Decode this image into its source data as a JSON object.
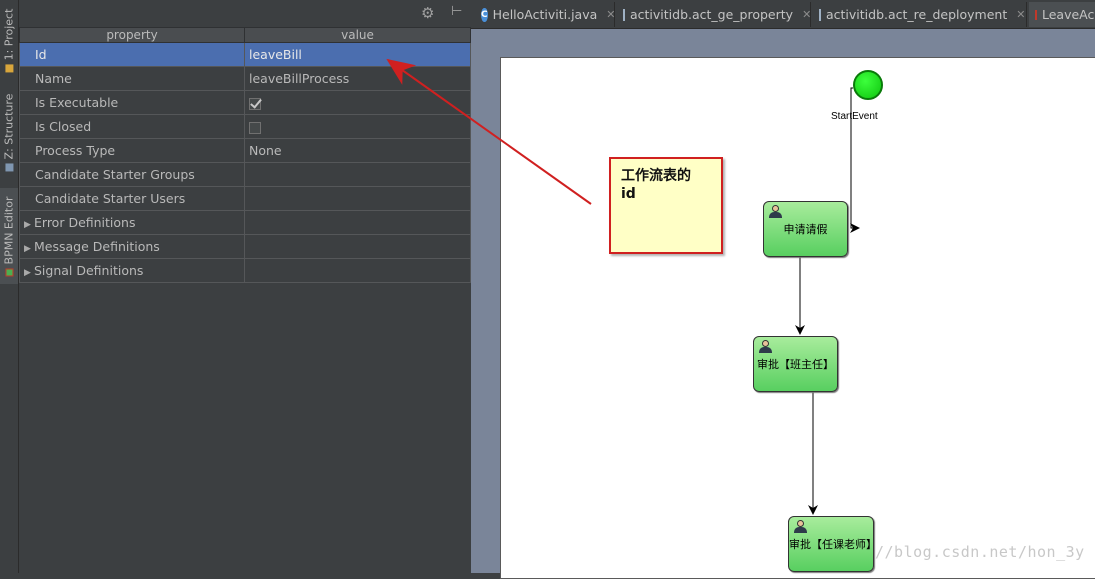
{
  "side_tabs": [
    {
      "label": "1: Project"
    },
    {
      "label": "Z: Structure"
    },
    {
      "label": "BPMN Editor"
    }
  ],
  "properties": {
    "header": {
      "property": "property",
      "value": "value"
    },
    "rows": [
      {
        "name": "Id",
        "value": "leaveBill",
        "selected": true
      },
      {
        "name": "Name",
        "value": "leaveBillProcess"
      },
      {
        "name": "Is Executable",
        "checkbox": true
      },
      {
        "name": "Is Closed",
        "checkbox": false
      },
      {
        "name": "Process Type",
        "value": "None"
      },
      {
        "name": "Candidate Starter Groups",
        "value": ""
      },
      {
        "name": "Candidate Starter Users",
        "value": ""
      },
      {
        "name": "Error Definitions",
        "value": "",
        "expandable": true
      },
      {
        "name": "Message Definitions",
        "value": "",
        "expandable": true
      },
      {
        "name": "Signal Definitions",
        "value": "",
        "expandable": true
      }
    ]
  },
  "tabs": [
    {
      "label": "HelloActiviti.java",
      "icon": "class-icon"
    },
    {
      "label": "activitidb.act_ge_property",
      "icon": "table-icon"
    },
    {
      "label": "activitidb.act_re_deployment",
      "icon": "table-icon"
    },
    {
      "label": "LeaveAc",
      "icon": "bpmn-icon"
    }
  ],
  "diagram": {
    "start_event_label": "StartEvent",
    "tasks": [
      {
        "label": "申请请假"
      },
      {
        "label": "审批【班主任】"
      },
      {
        "label": "审批【任课老师】"
      }
    ]
  },
  "callout": {
    "line1": "工作流表的",
    "line2": "id"
  },
  "watermark": "//blog.csdn.net/hon_3y",
  "colors": {
    "selection": "#4b6eaf",
    "task_green": "#7ddc78",
    "start_green": "#1fe21f",
    "annotation_red": "#d02020"
  }
}
